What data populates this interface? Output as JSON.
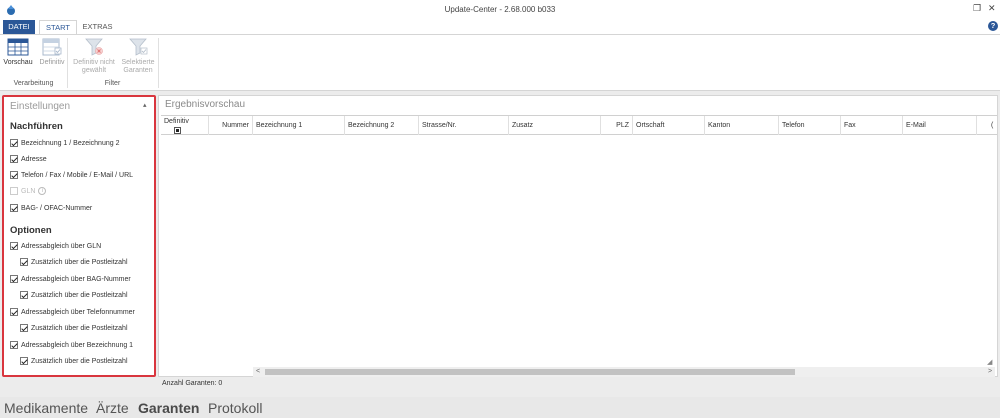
{
  "window": {
    "title": "Update-Center - 2.68.000 b033",
    "restore_glyph": "❐",
    "close_glyph": "✕",
    "icon": "app-logo-icon"
  },
  "ribbon": {
    "tabs": [
      {
        "label": "DATEI"
      },
      {
        "label": "START"
      },
      {
        "label": "EXTRAS"
      }
    ],
    "help_glyph": "?",
    "buttons": {
      "vorschau": "Vorschau",
      "definitiv": "Definitiv",
      "definitiv_nicht_line1": "Definitiv nicht",
      "definitiv_nicht_line2": "gewählt",
      "selektierte_line1": "Selektierte",
      "selektierte_line2": "Garanten"
    },
    "groups": {
      "verarbeitung": "Verarbeitung",
      "filter": "Filter"
    }
  },
  "settings": {
    "title": "Einstellungen",
    "pin_glyph": "▴",
    "nachfuehren": {
      "heading": "Nachführen",
      "items": [
        {
          "label": "Bezeichnung 1 / Bezeichnung 2",
          "checked": true
        },
        {
          "label": "Adresse",
          "checked": true
        },
        {
          "label": "Telefon / Fax / Mobile / E-Mail / URL",
          "checked": true
        },
        {
          "label": "GLN",
          "checked": false,
          "disabled": true
        },
        {
          "label": "BAG- / OFAC-Nummer",
          "checked": true
        }
      ],
      "info_glyph": "i"
    },
    "optionen": {
      "heading": "Optionen",
      "items": [
        {
          "label": "Adressabgleich über GLN",
          "checked": true
        },
        {
          "label": "Zusätzlich über die Postleitzahl",
          "checked": true
        },
        {
          "label": "Adressabgleich über BAG-Nummer",
          "checked": true
        },
        {
          "label": "Zusätzlich über die Postleitzahl",
          "checked": true
        },
        {
          "label": "Adressabgleich über Telefonnummer",
          "checked": true
        },
        {
          "label": "Zusätzlich über die Postleitzahl",
          "checked": true
        },
        {
          "label": "Adressabgleich über Bezeichnung 1",
          "checked": true
        },
        {
          "label": "Zusätzlich über die Postleitzahl",
          "checked": true
        }
      ]
    }
  },
  "results": {
    "title": "Ergebnisvorschau",
    "columns": [
      "Definitiv",
      "Nummer",
      "Bezeichnung 1",
      "Bezeichnung 2",
      "Strasse/Nr.",
      "Zusatz",
      "PLZ",
      "Ortschaft",
      "Kanton",
      "Telefon",
      "Fax",
      "E-Mail",
      "("
    ],
    "scroll_left": "<",
    "scroll_right": ">",
    "grip_glyph": "◢"
  },
  "status": {
    "text": "Anzahl Garanten: 0"
  },
  "bottom_nav": [
    {
      "label": "Medikamente",
      "active": false
    },
    {
      "label": "Ärzte",
      "active": false
    },
    {
      "label": "Garanten",
      "active": true
    },
    {
      "label": "Protokoll",
      "active": false
    }
  ],
  "colors": {
    "accent": "#2b5797",
    "highlight_border": "#d9363e"
  }
}
